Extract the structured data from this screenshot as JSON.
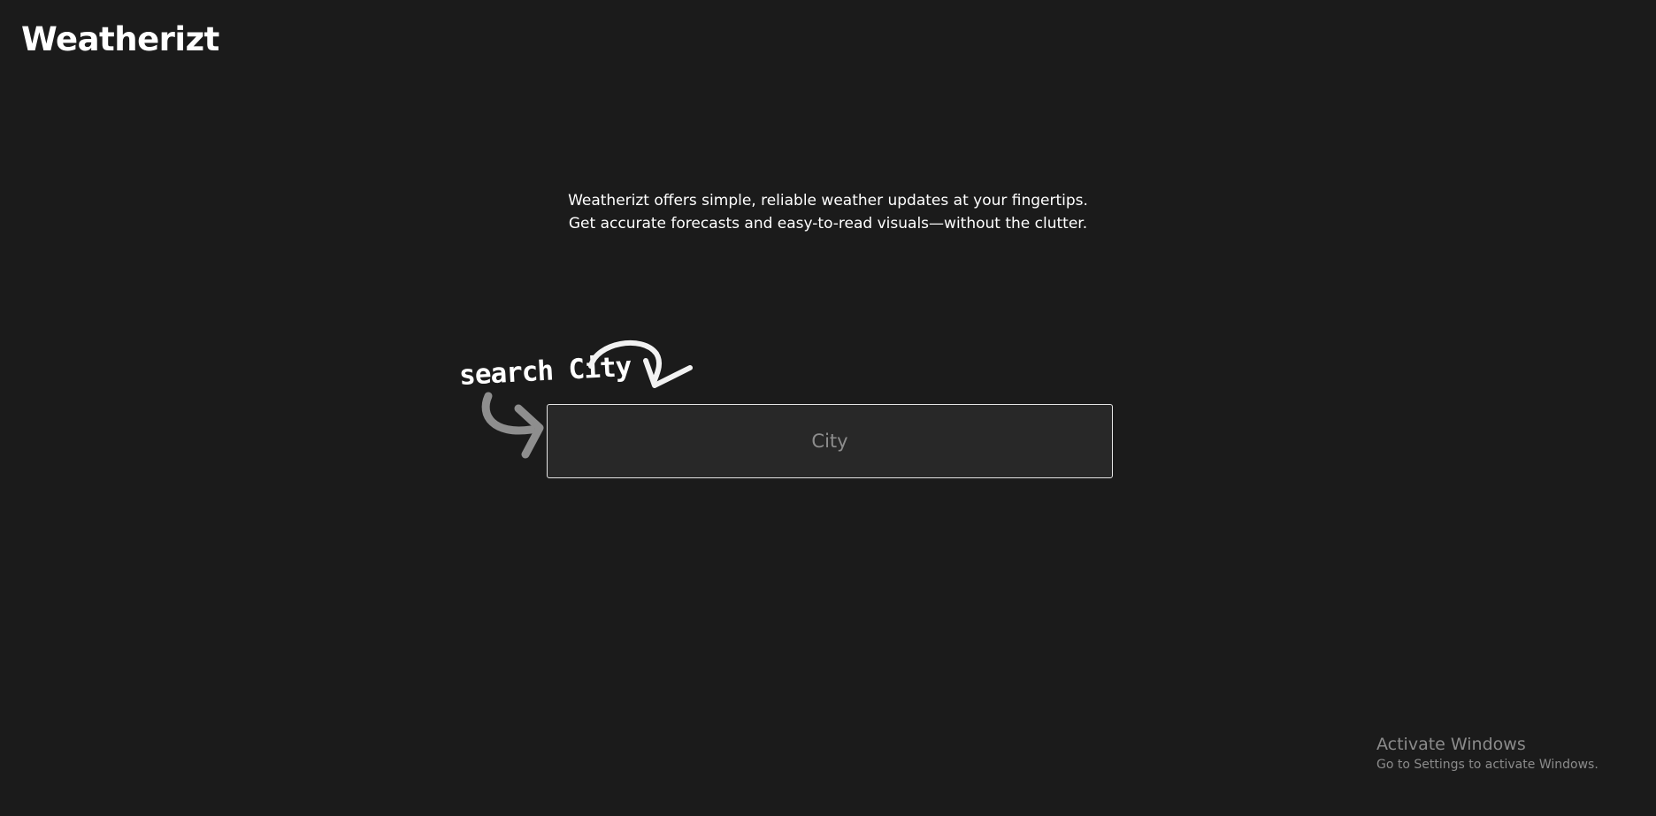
{
  "brand": {
    "name": "Weatherizt"
  },
  "hero": {
    "description": "Weatherizt offers simple, reliable weather updates at your fingertips. Get accurate forecasts and easy-to-read visuals—without the clutter."
  },
  "search": {
    "hint_label": "search City",
    "placeholder": "City",
    "value": ""
  },
  "icons": {
    "hint_arrow_top": "curved-arrow-icon",
    "hint_arrow_left": "curved-arrow-icon"
  },
  "colors": {
    "background": "#1b1b1b",
    "input_background": "#282828",
    "input_border": "#e6e6e6",
    "text": "#ffffff",
    "placeholder": "#8d8d8d",
    "arrow_light": "#f2f2f2",
    "arrow_gray": "#8e8e8e"
  },
  "os_watermark": {
    "title": "Activate Windows",
    "subtitle": "Go to Settings to activate Windows."
  }
}
